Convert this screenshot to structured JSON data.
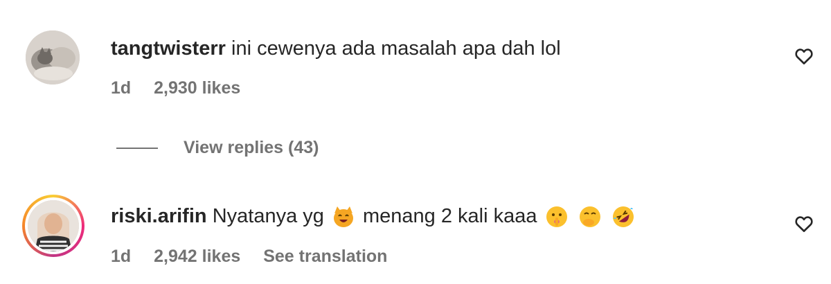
{
  "comments": [
    {
      "username": "tangtwisterr",
      "text": "ini cewenya ada masalah apa dah lol",
      "time": "1d",
      "likes": "2,930 likes",
      "avatar_icon": "cat-photo-avatar",
      "view_replies": "View replies (43)"
    },
    {
      "username": "riski.arifin",
      "text_before": "Nyatanya yg",
      "emoji_1": "cat-face-emoji",
      "text_after": "menang 2 kali kaaa",
      "emoji_2": "shushing-face-emoji",
      "emoji_3": "face-with-hand-over-mouth-emoji",
      "emoji_4": "rolling-on-floor-laughing-emoji",
      "time": "1d",
      "likes": "2,942 likes",
      "see_translation": "See translation",
      "avatar_icon": "woman-photo-avatar",
      "story_ring": true
    }
  ],
  "icons": {
    "like": "heart-outline-icon"
  },
  "colors": {
    "text": "#262626",
    "secondary": "#737373",
    "ring_start": "#f9ce34",
    "ring_mid": "#ee2a7b"
  }
}
